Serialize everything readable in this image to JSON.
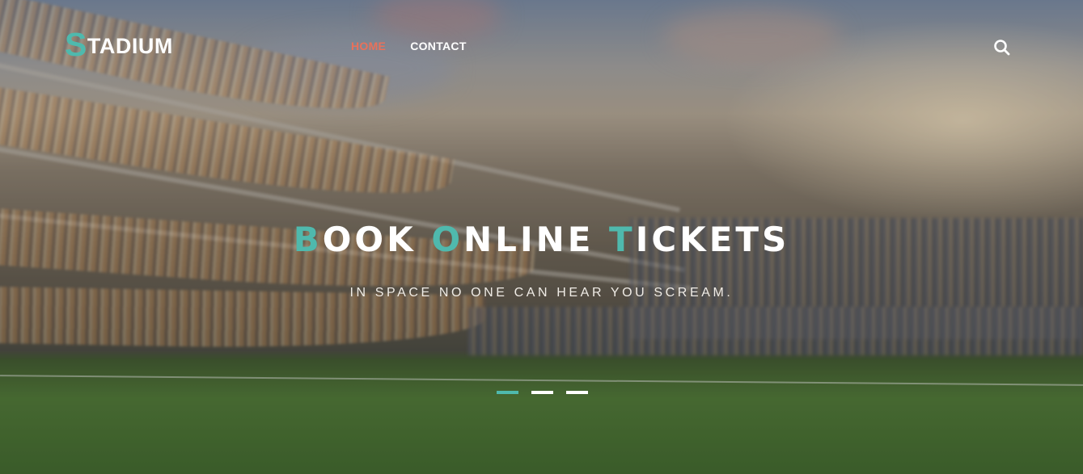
{
  "logo": {
    "first_letter": "S",
    "rest": "TADIUM"
  },
  "nav": {
    "items": [
      {
        "label": "HOME",
        "active": true
      },
      {
        "label": "CONTACT",
        "active": false
      }
    ]
  },
  "search": {
    "icon": "search-icon"
  },
  "hero": {
    "headline_words": [
      {
        "first": "B",
        "rest": "OOK"
      },
      {
        "first": "O",
        "rest": "NLINE"
      },
      {
        "first": "T",
        "rest": "ICKETS"
      }
    ],
    "subtitle": "IN SPACE NO ONE CAN HEAR YOU SCREAM."
  },
  "slider": {
    "slide_count": 3,
    "active_index": 0
  },
  "colors": {
    "accent": "#4fb9ad",
    "nav_active": "#e8715a",
    "text": "#ffffff"
  }
}
